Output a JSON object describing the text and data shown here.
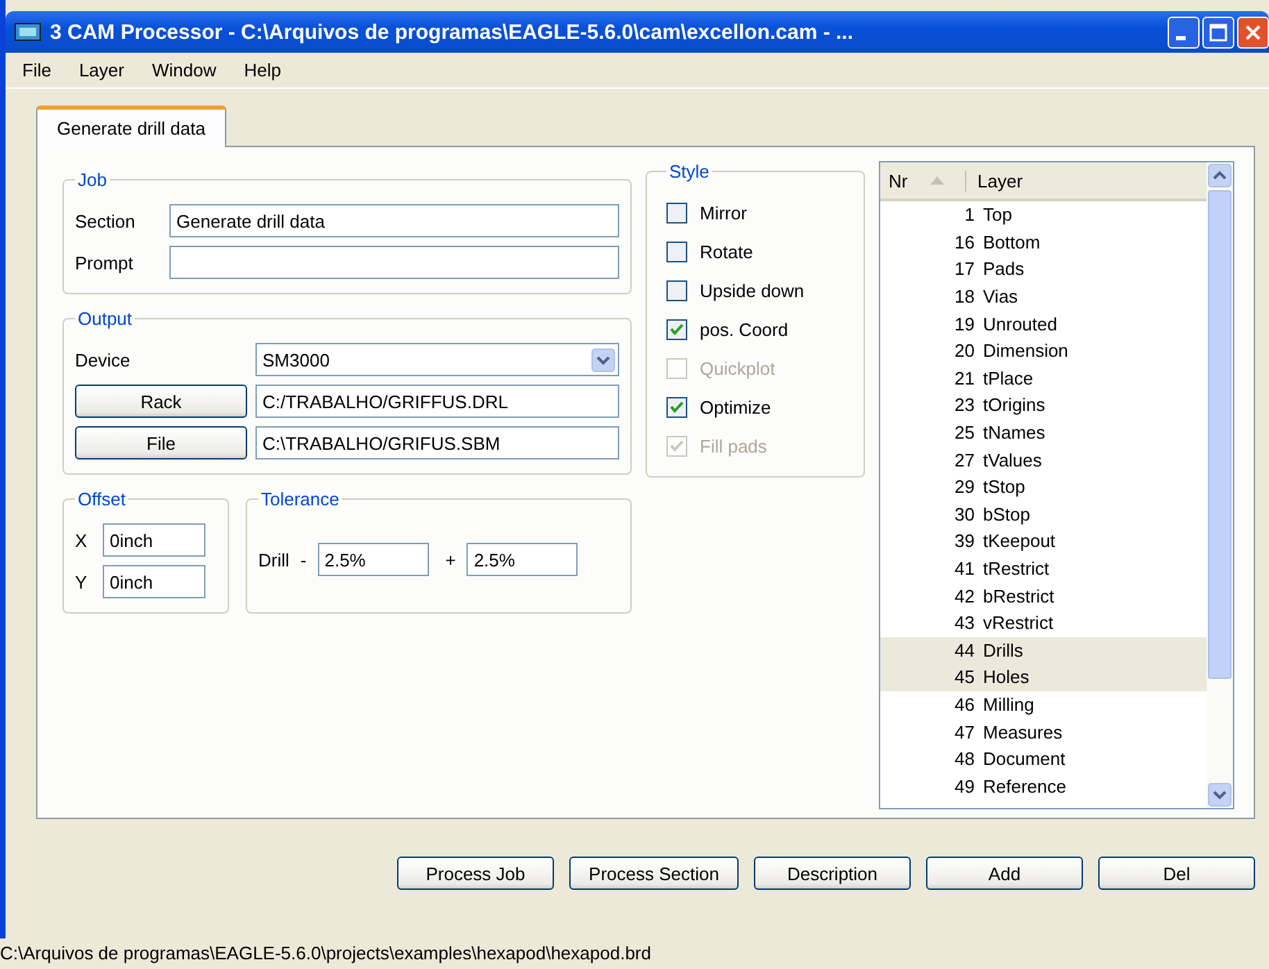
{
  "window": {
    "title": "3 CAM Processor - C:\\Arquivos de programas\\EAGLE-5.6.0\\cam\\excellon.cam - ..."
  },
  "menu": [
    "File",
    "Layer",
    "Window",
    "Help"
  ],
  "tabs": [
    {
      "label": "Generate drill data",
      "selected": true
    }
  ],
  "job": {
    "title": "Job",
    "section": {
      "label": "Section",
      "value": "Generate drill data"
    },
    "prompt": {
      "label": "Prompt"
    }
  },
  "output": {
    "title": "Output",
    "device": {
      "label": "Device",
      "value": "SM3000"
    },
    "rack": {
      "button": "Rack",
      "value": "C:/TRABALHO/GRIFFUS.DRL"
    },
    "file": {
      "button": "File",
      "value": "C:\\TRABALHO/GRIFUS.SBM"
    }
  },
  "offset": {
    "title": "Offset",
    "x": {
      "label": "X",
      "value": "0inch"
    },
    "y": {
      "label": "Y",
      "value": "0inch"
    }
  },
  "tolerance": {
    "title": "Tolerance",
    "label": "Drill",
    "minus_sign": "-",
    "minus_value": "2.5%",
    "plus_sign": "+",
    "plus_value": "2.5%"
  },
  "style": {
    "title": "Style",
    "options": [
      {
        "label": "Mirror",
        "checked": false,
        "disabled": false
      },
      {
        "label": "Rotate",
        "checked": false,
        "disabled": false
      },
      {
        "label": "Upside down",
        "checked": false,
        "disabled": false
      },
      {
        "label": "pos. Coord",
        "checked": true,
        "disabled": false
      },
      {
        "label": "Quickplot",
        "checked": false,
        "disabled": true
      },
      {
        "label": "Optimize",
        "checked": true,
        "disabled": false
      },
      {
        "label": "Fill pads",
        "checked": true,
        "disabled": true
      }
    ]
  },
  "layers": {
    "columns": [
      "Nr",
      "Layer"
    ],
    "rows": [
      {
        "nr": "1",
        "name": "Top",
        "selected": false
      },
      {
        "nr": "16",
        "name": "Bottom",
        "selected": false
      },
      {
        "nr": "17",
        "name": "Pads",
        "selected": false
      },
      {
        "nr": "18",
        "name": "Vias",
        "selected": false
      },
      {
        "nr": "19",
        "name": "Unrouted",
        "selected": false
      },
      {
        "nr": "20",
        "name": "Dimension",
        "selected": false
      },
      {
        "nr": "21",
        "name": "tPlace",
        "selected": false
      },
      {
        "nr": "23",
        "name": "tOrigins",
        "selected": false
      },
      {
        "nr": "25",
        "name": "tNames",
        "selected": false
      },
      {
        "nr": "27",
        "name": "tValues",
        "selected": false
      },
      {
        "nr": "29",
        "name": "tStop",
        "selected": false
      },
      {
        "nr": "30",
        "name": "bStop",
        "selected": false
      },
      {
        "nr": "39",
        "name": "tKeepout",
        "selected": false
      },
      {
        "nr": "41",
        "name": "tRestrict",
        "selected": false
      },
      {
        "nr": "42",
        "name": "bRestrict",
        "selected": false
      },
      {
        "nr": "43",
        "name": "vRestrict",
        "selected": false
      },
      {
        "nr": "44",
        "name": "Drills",
        "selected": true
      },
      {
        "nr": "45",
        "name": "Holes",
        "selected": true
      },
      {
        "nr": "46",
        "name": "Milling",
        "selected": false
      },
      {
        "nr": "47",
        "name": "Measures",
        "selected": false
      },
      {
        "nr": "48",
        "name": "Document",
        "selected": false
      },
      {
        "nr": "49",
        "name": "Reference",
        "selected": false
      }
    ]
  },
  "buttons": [
    "Process Job",
    "Process Section",
    "Description",
    "Add",
    "Del"
  ],
  "status_bar": "C:\\Arquivos de programas\\EAGLE-5.6.0\\projects\\examples\\hexapod\\hexapod.brd"
}
